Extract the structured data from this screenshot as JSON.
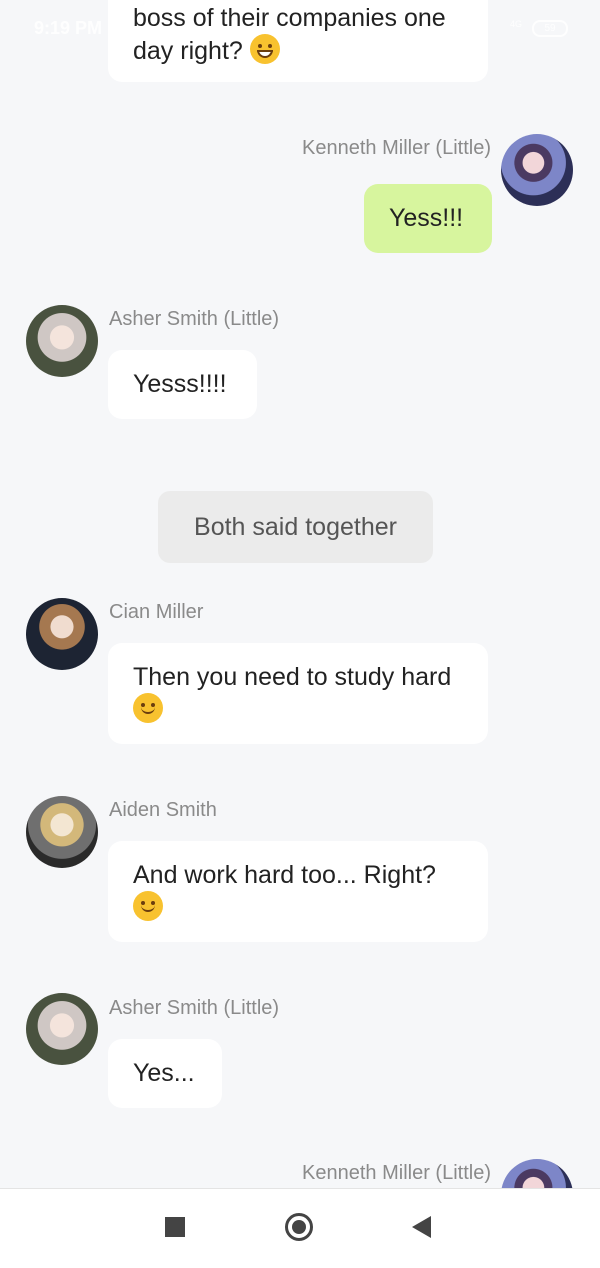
{
  "status_bar": {
    "time": "9:19 PM",
    "network": "4G",
    "battery": "59"
  },
  "messages": [
    {
      "sender": "",
      "text": "boss of their companies one day right?",
      "emoji": "grinning-face-emoji"
    },
    {
      "sender": "Kenneth Miller (Little)",
      "text": "Yess!!!"
    },
    {
      "sender": "Asher Smith (Little)",
      "text": "Yesss!!!!"
    },
    {
      "narration": "Both said together"
    },
    {
      "sender": "Cian Miller",
      "text": "Then you need to study hard",
      "emoji": "smiling-face-emoji"
    },
    {
      "sender": "Aiden Smith",
      "text": "And work hard too... Right?",
      "emoji": "smiling-face-emoji"
    },
    {
      "sender": "Asher Smith (Little)",
      "text": "Yes..."
    },
    {
      "sender": "Kenneth Miller (Little)"
    }
  ],
  "colors": {
    "background": "#f6f7f9",
    "own_bubble": "#d7f59e",
    "other_bubble": "#ffffff",
    "narration_bg": "#ebebeb",
    "sender_name": "#8a8a8a"
  },
  "nav_bar": {
    "recent_icon": "square-icon",
    "home_icon": "circle-home-icon",
    "back_icon": "triangle-back-icon"
  }
}
